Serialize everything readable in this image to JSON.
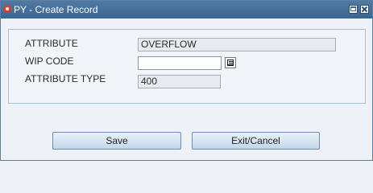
{
  "window": {
    "title": "PY - Create Record",
    "logo": "oracle-logo",
    "controls": [
      "restore-icon",
      "close-icon"
    ]
  },
  "form": {
    "attribute": {
      "label": "ATTRIBUTE",
      "value": "OVERFLOW"
    },
    "wip_code": {
      "label": "WIP CODE",
      "value": ""
    },
    "attribute_type": {
      "label": "ATTRIBUTE TYPE",
      "value": "400"
    }
  },
  "buttons": {
    "save": "Save",
    "exit_cancel": "Exit/Cancel"
  },
  "colors": {
    "titlebar": "#3f6b98",
    "background": "#eef2f6",
    "button_border": "#6b8fb5"
  }
}
